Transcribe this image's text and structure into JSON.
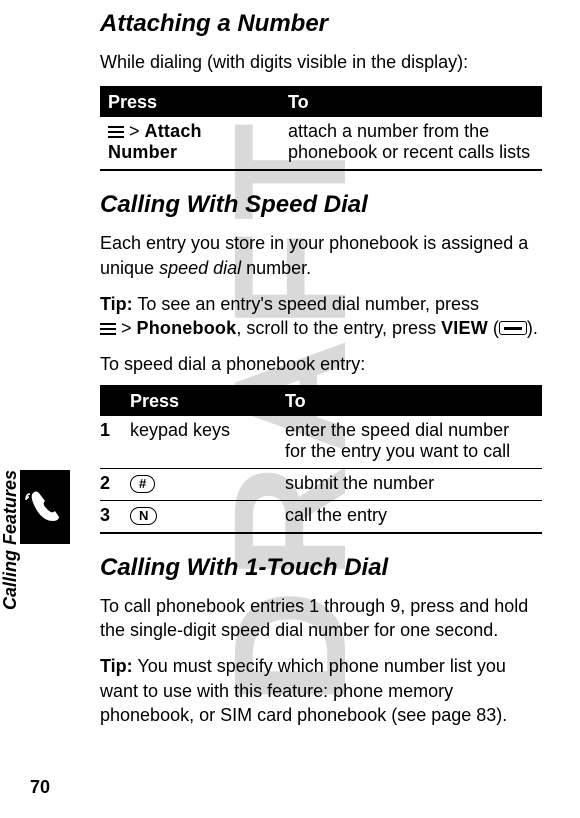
{
  "page_number": "70",
  "side_label": "Calling Features",
  "watermark": "DRAFT",
  "sections": {
    "s1": {
      "heading": "Attaching a Number",
      "intro": "While dialing (with digits visible in the display):",
      "table": {
        "h1": "Press",
        "h2": "To",
        "r1_press_suffix": " > ",
        "r1_press_label": "Attach Number",
        "r1_to": "attach a number from the phonebook or recent calls lists"
      }
    },
    "s2": {
      "heading": "Calling With Speed Dial",
      "p1_a": "Each entry you store in your phonebook is assigned a unique ",
      "p1_em": "speed dial",
      "p1_b": " number.",
      "tip_label": "Tip:",
      "tip_a": " To see an entry's speed dial number, press",
      "tip_sep1": " > ",
      "tip_phonebook": "Phonebook",
      "tip_b": ", scroll to the entry, press ",
      "tip_view": "VIEW",
      "tip_c": " (",
      "tip_d": ").",
      "p3": "To speed dial a phonebook entry:",
      "table": {
        "h1": "Press",
        "h2": "To",
        "r1_n": "1",
        "r1_press": "keypad keys",
        "r1_to": "enter the speed dial number for the entry you want to call",
        "r2_n": "2",
        "r2_key": "#",
        "r2_to": "submit the number",
        "r3_n": "3",
        "r3_key": "N",
        "r3_to": "call the entry"
      }
    },
    "s3": {
      "heading": "Calling With 1-Touch Dial",
      "p1": "To call phonebook entries 1 through 9, press and hold the single-digit speed dial number for one second.",
      "tip_label": "Tip:",
      "tip_body": " You must specify which phone number list you want to use with this feature: phone memory phonebook, or SIM card phonebook (see page 83)."
    }
  }
}
